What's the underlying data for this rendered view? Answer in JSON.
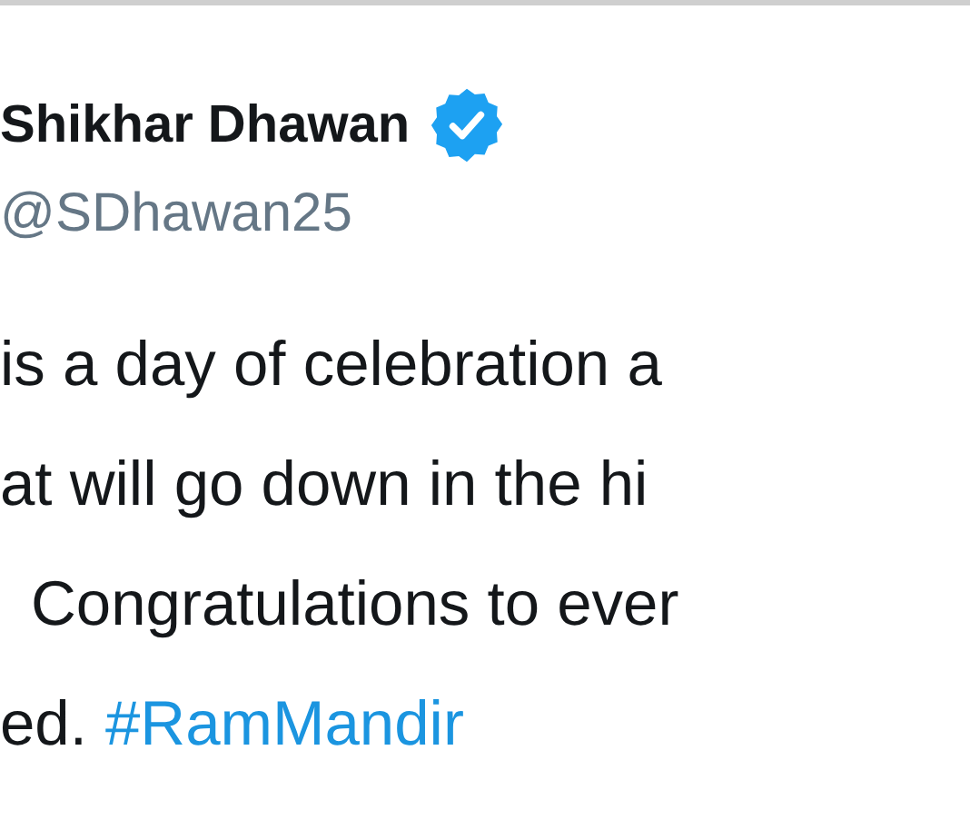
{
  "tweet": {
    "author_name": "Shikhar Dhawan",
    "verified": true,
    "handle": "@SDhawan25",
    "body_lines": [
      "is a day of celebration a",
      "at will go down in the hi",
      "Congratulations to ever"
    ],
    "last_line": {
      "text": "ed.",
      "hashtag": "#RamMandir"
    }
  }
}
